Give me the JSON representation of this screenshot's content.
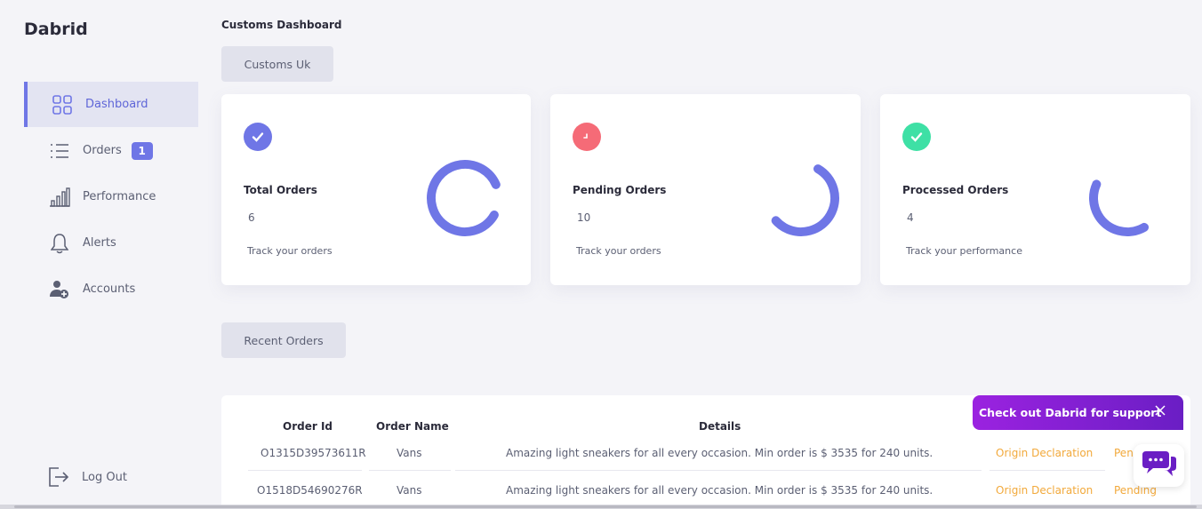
{
  "app": {
    "brand": "Dabrid"
  },
  "sidebar": {
    "items": [
      {
        "label": "Dashboard",
        "icon": "dashboard-grid-icon",
        "active": true
      },
      {
        "label": "Orders",
        "icon": "list-icon",
        "badge": "1"
      },
      {
        "label": "Performance",
        "icon": "bar-chart-icon"
      },
      {
        "label": "Alerts",
        "icon": "bell-icon"
      },
      {
        "label": "Accounts",
        "icon": "user-add-icon"
      }
    ],
    "logout_label": "Log Out"
  },
  "header": {
    "title": "Customs Dashboard",
    "selector_label": "Customs Uk"
  },
  "cards": [
    {
      "title": "Total Orders",
      "value": "6",
      "subtitle": "Track your orders",
      "icon": "check-icon",
      "icon_color": "#6f76e6",
      "ring_fraction": 0.85
    },
    {
      "title": "Pending Orders",
      "value": "10",
      "subtitle": "Track your orders",
      "icon": "stopwatch-icon",
      "icon_color": "#f56b77",
      "ring_fraction": 0.55
    },
    {
      "title": "Processed Orders",
      "value": "4",
      "subtitle": "Track your performance",
      "icon": "check-icon",
      "icon_color": "#3ee0a5",
      "ring_fraction": 0.4
    }
  ],
  "recent": {
    "button_label": "Recent Orders",
    "columns": [
      "Order Id",
      "Order Name",
      "Details"
    ],
    "rows": [
      {
        "id": "O1315D39573611R",
        "name": "Vans",
        "details": "Amazing light sneakers for all every occasion. Min order is $ 3535 for 240 units.",
        "type": "Origin Declaration",
        "status": "Pending"
      },
      {
        "id": "O1518D54690276R",
        "name": "Vans",
        "details": "Amazing light sneakers for all every occasion. Min order is $ 3535 for 240 units.",
        "type": "Origin Declaration",
        "status": "Pending"
      }
    ]
  },
  "support": {
    "text": "Check out Dabrid for support"
  },
  "colors": {
    "accent": "#6f76e6",
    "warning": "#f2a93b",
    "support_gradient": "#9b22e0"
  }
}
